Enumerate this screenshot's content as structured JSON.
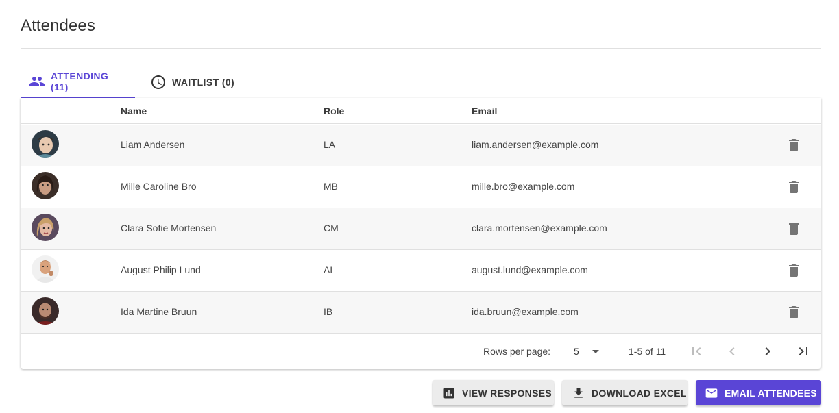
{
  "page": {
    "title": "Attendees"
  },
  "tabs": [
    {
      "label": "ATTENDING (11)",
      "icon": "people-icon",
      "active": true
    },
    {
      "label": "WAITLIST (0)",
      "icon": "clock-icon",
      "active": false
    }
  ],
  "table": {
    "columns": [
      "",
      "Name",
      "Role",
      "Email",
      ""
    ],
    "rows": [
      {
        "avatar": "avatar-photo",
        "name": "Liam Andersen",
        "role": "LA",
        "email": "liam.andersen@example.com"
      },
      {
        "avatar": "avatar-photo",
        "name": "Mille Caroline Bro",
        "role": "MB",
        "email": "mille.bro@example.com"
      },
      {
        "avatar": "avatar-photo",
        "name": "Clara Sofie Mortensen",
        "role": "CM",
        "email": "clara.mortensen@example.com"
      },
      {
        "avatar": "avatar-photo",
        "name": "August Philip Lund",
        "role": "AL",
        "email": "august.lund@example.com"
      },
      {
        "avatar": "avatar-photo",
        "name": "Ida Martine Bruun",
        "role": "IB",
        "email": "ida.bruun@example.com"
      }
    ]
  },
  "pagination": {
    "rows_per_page_label": "Rows per page:",
    "rows_per_page": "5",
    "range": "1-5 of 11"
  },
  "actions": {
    "view_responses": "VIEW RESPONSES",
    "download_excel": "DOWNLOAD EXCEL",
    "email_attendees": "EMAIL ATTENDEES"
  },
  "colors": {
    "accent": "#5a45d6",
    "row_stripe": "#f7f7f7",
    "icon_grey": "#757575"
  }
}
